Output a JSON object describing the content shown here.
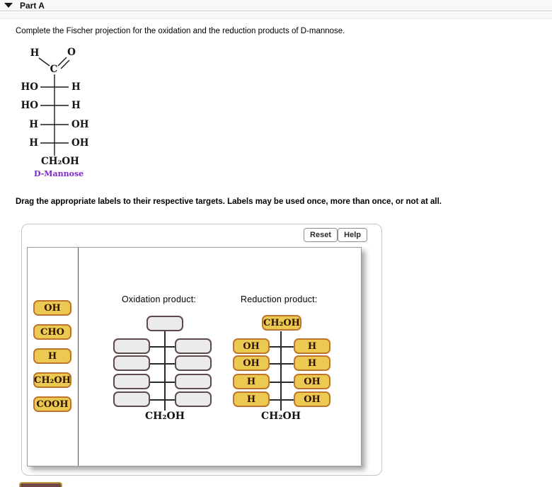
{
  "header": {
    "part_label": "Part A"
  },
  "instruction": "Complete the Fischer projection for the oxidation and the reduction products of D-mannose.",
  "mannose": {
    "top": {
      "h": "H",
      "c": "C",
      "o": "O"
    },
    "rows": [
      {
        "left": "HO",
        "right": "H"
      },
      {
        "left": "HO",
        "right": "H"
      },
      {
        "left": "H",
        "right": "OH"
      },
      {
        "left": "H",
        "right": "OH"
      }
    ],
    "bottom": "CH₂OH",
    "caption": "D-Mannose"
  },
  "drag_instruction": "Drag the appropriate labels to their respective targets. Labels may be used once, more than once, or not at all.",
  "toolbar": {
    "reset_label": "Reset",
    "help_label": "Help"
  },
  "label_bank": [
    "OH",
    "CHO",
    "H",
    "CH₂OH",
    "COOH"
  ],
  "oxidation": {
    "title": "Oxidation product:",
    "bottom": "CH₂OH"
  },
  "reduction": {
    "title": "Reduction product:",
    "top": "CH₂OH",
    "rows": [
      {
        "left": "OH",
        "right": "H"
      },
      {
        "left": "OH",
        "right": "H"
      },
      {
        "left": "H",
        "right": "OH"
      },
      {
        "left": "H",
        "right": "OH"
      }
    ],
    "bottom": "CH₂OH"
  },
  "colors": {
    "chip_fill": "#ecca52",
    "chip_border": "#bd762c",
    "target_fill": "#ebebeb",
    "target_border": "#5d4a4a",
    "caption_purple": "#7d26cd",
    "submit_fill": "#6f4845",
    "submit_border": "#c19a3f"
  }
}
